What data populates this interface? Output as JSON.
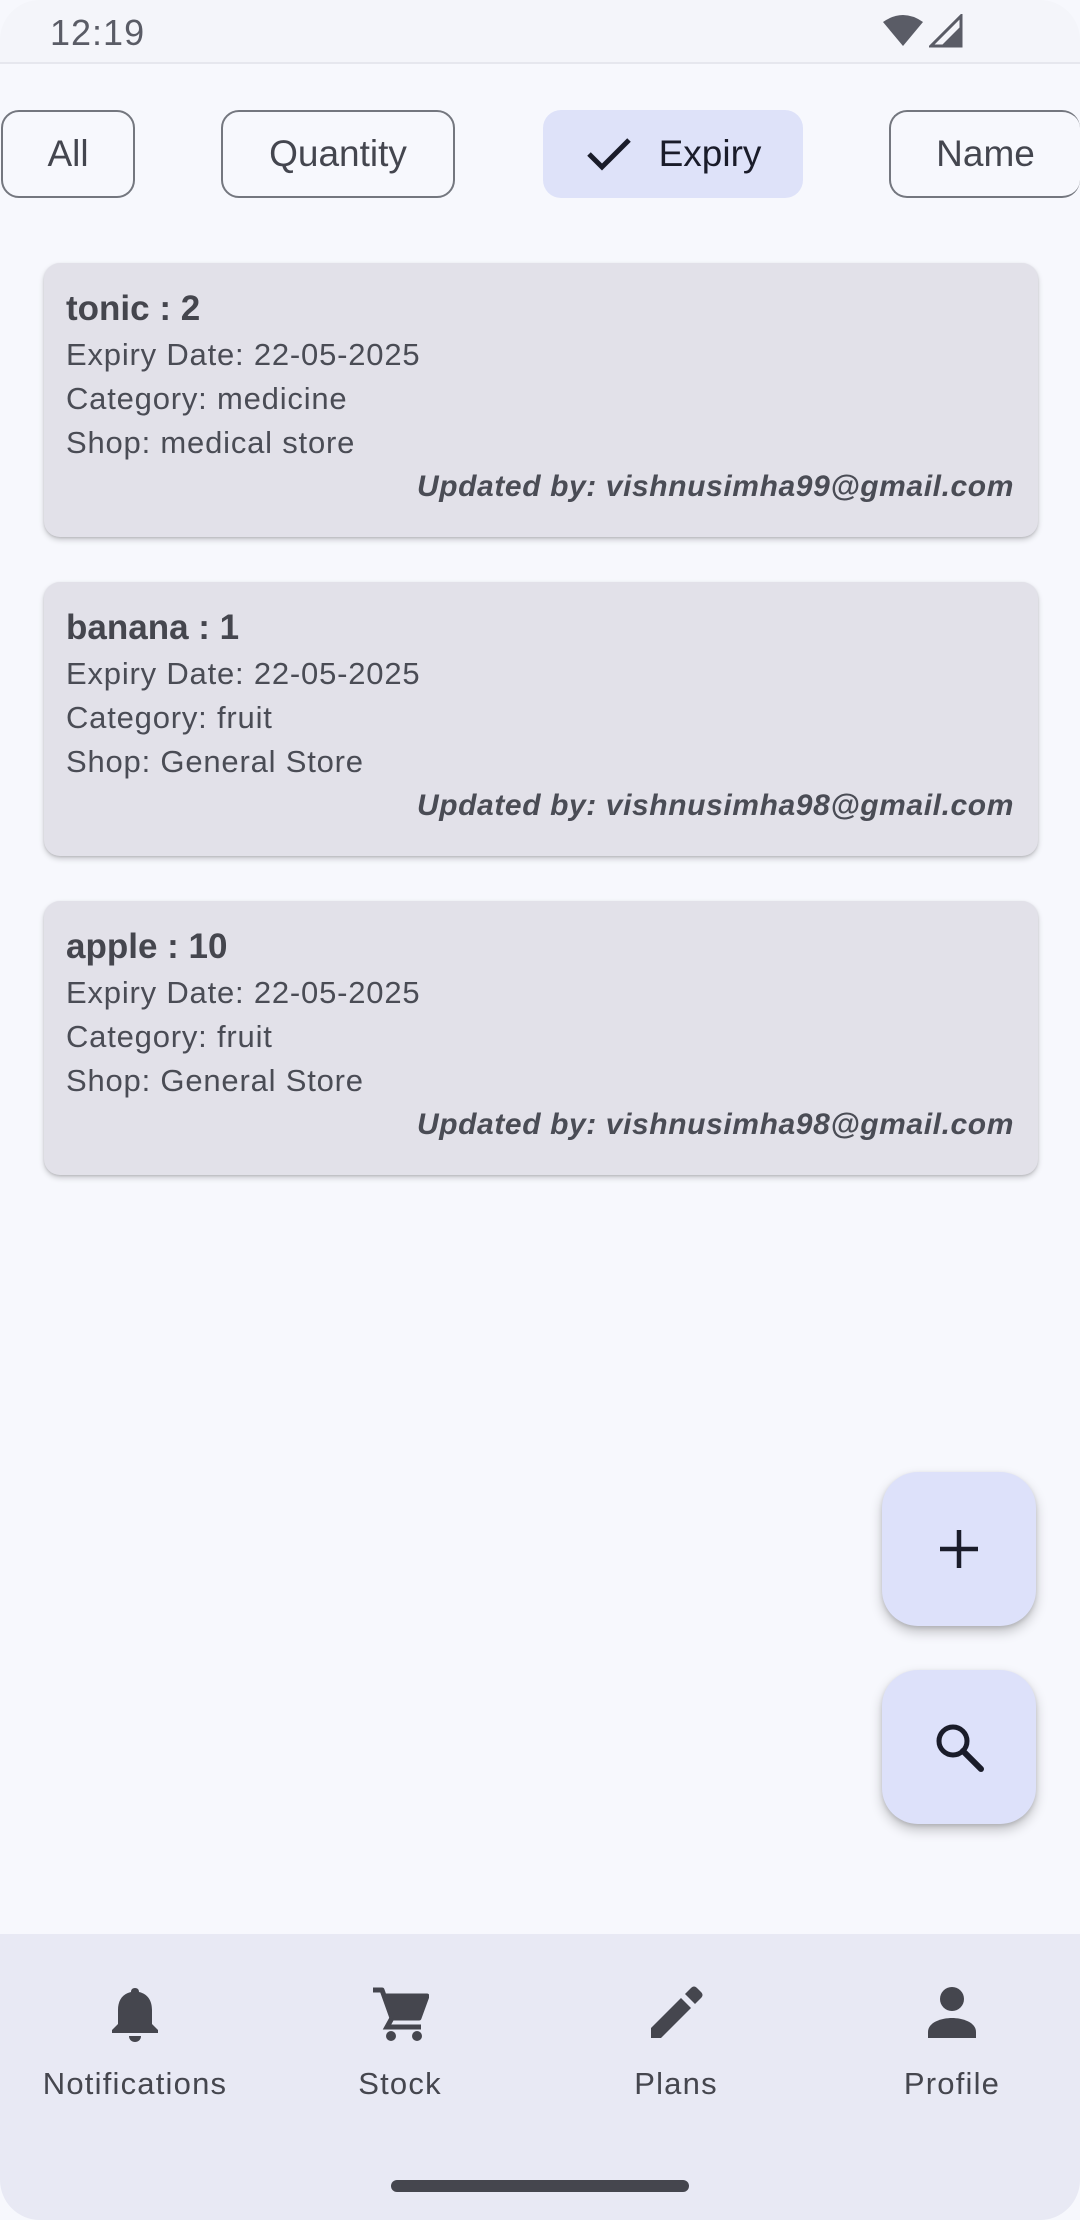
{
  "status_bar": {
    "time": "12:19"
  },
  "filters": {
    "chips": [
      {
        "label": "All",
        "selected": false
      },
      {
        "label": "Quantity",
        "selected": false
      },
      {
        "label": "Expiry",
        "selected": true
      },
      {
        "label": "Name",
        "selected": false
      }
    ]
  },
  "items": [
    {
      "title": "tonic : 2",
      "expiry": "Expiry Date: 22-05-2025",
      "category": "Category: medicine",
      "shop": "Shop: medical store",
      "updated": "Updated by: vishnusimha99@gmail.com"
    },
    {
      "title": "banana : 1",
      "expiry": "Expiry Date: 22-05-2025",
      "category": "Category: fruit",
      "shop": "Shop: General Store",
      "updated": "Updated by: vishnusimha98@gmail.com"
    },
    {
      "title": "apple : 10",
      "expiry": "Expiry Date: 22-05-2025",
      "category": "Category: fruit",
      "shop": "Shop: General Store",
      "updated": "Updated by: vishnusimha98@gmail.com"
    }
  ],
  "fabs": {
    "add_icon": "plus-icon",
    "search_icon": "search-icon"
  },
  "bottom_nav": {
    "items": [
      {
        "label": "Notifications",
        "icon": "bell-icon"
      },
      {
        "label": "Stock",
        "icon": "cart-icon"
      },
      {
        "label": "Plans",
        "icon": "pencil-icon"
      },
      {
        "label": "Profile",
        "icon": "person-icon"
      }
    ]
  },
  "colors": {
    "background": "#f7f8fd",
    "card": "#e2e1e9",
    "selected_chip": "#dee2f9",
    "fab": "#dde1fa",
    "nav_bar": "#e8e9f4"
  }
}
